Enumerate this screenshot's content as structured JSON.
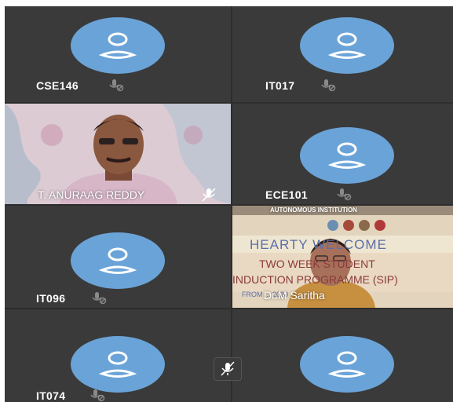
{
  "participants": [
    {
      "name": "CSE146",
      "mic": "muted-mic-icon"
    },
    {
      "name": "IT017",
      "mic": "muted-mic-icon"
    },
    {
      "name": "T. ANURAAG REDDY",
      "mic": "muted-mic-icon"
    },
    {
      "name": "ECE101",
      "mic": "muted-mic-icon"
    },
    {
      "name": "IT096",
      "mic": "muted-mic-icon"
    },
    {
      "name": "Dr.M Saritha",
      "mic": "none"
    },
    {
      "name": "IT074",
      "mic": "muted-mic-icon"
    },
    {
      "name": "",
      "mic": "none"
    }
  ],
  "banner": {
    "line1": "AUTONOMOUS INSTITUTION",
    "line2": "HEARTY WELCOME",
    "line3": "TWO WEEK STUDENT",
    "line4": "INDUCTION PROGRAMME (SIP)",
    "line5": "FROM ... 2020"
  },
  "controls": {
    "mute_icon": "muted-mic-icon"
  },
  "colors": {
    "avatar": "#6aa3d7",
    "tile": "#3a3a3a",
    "background": "#2d2d2d"
  }
}
